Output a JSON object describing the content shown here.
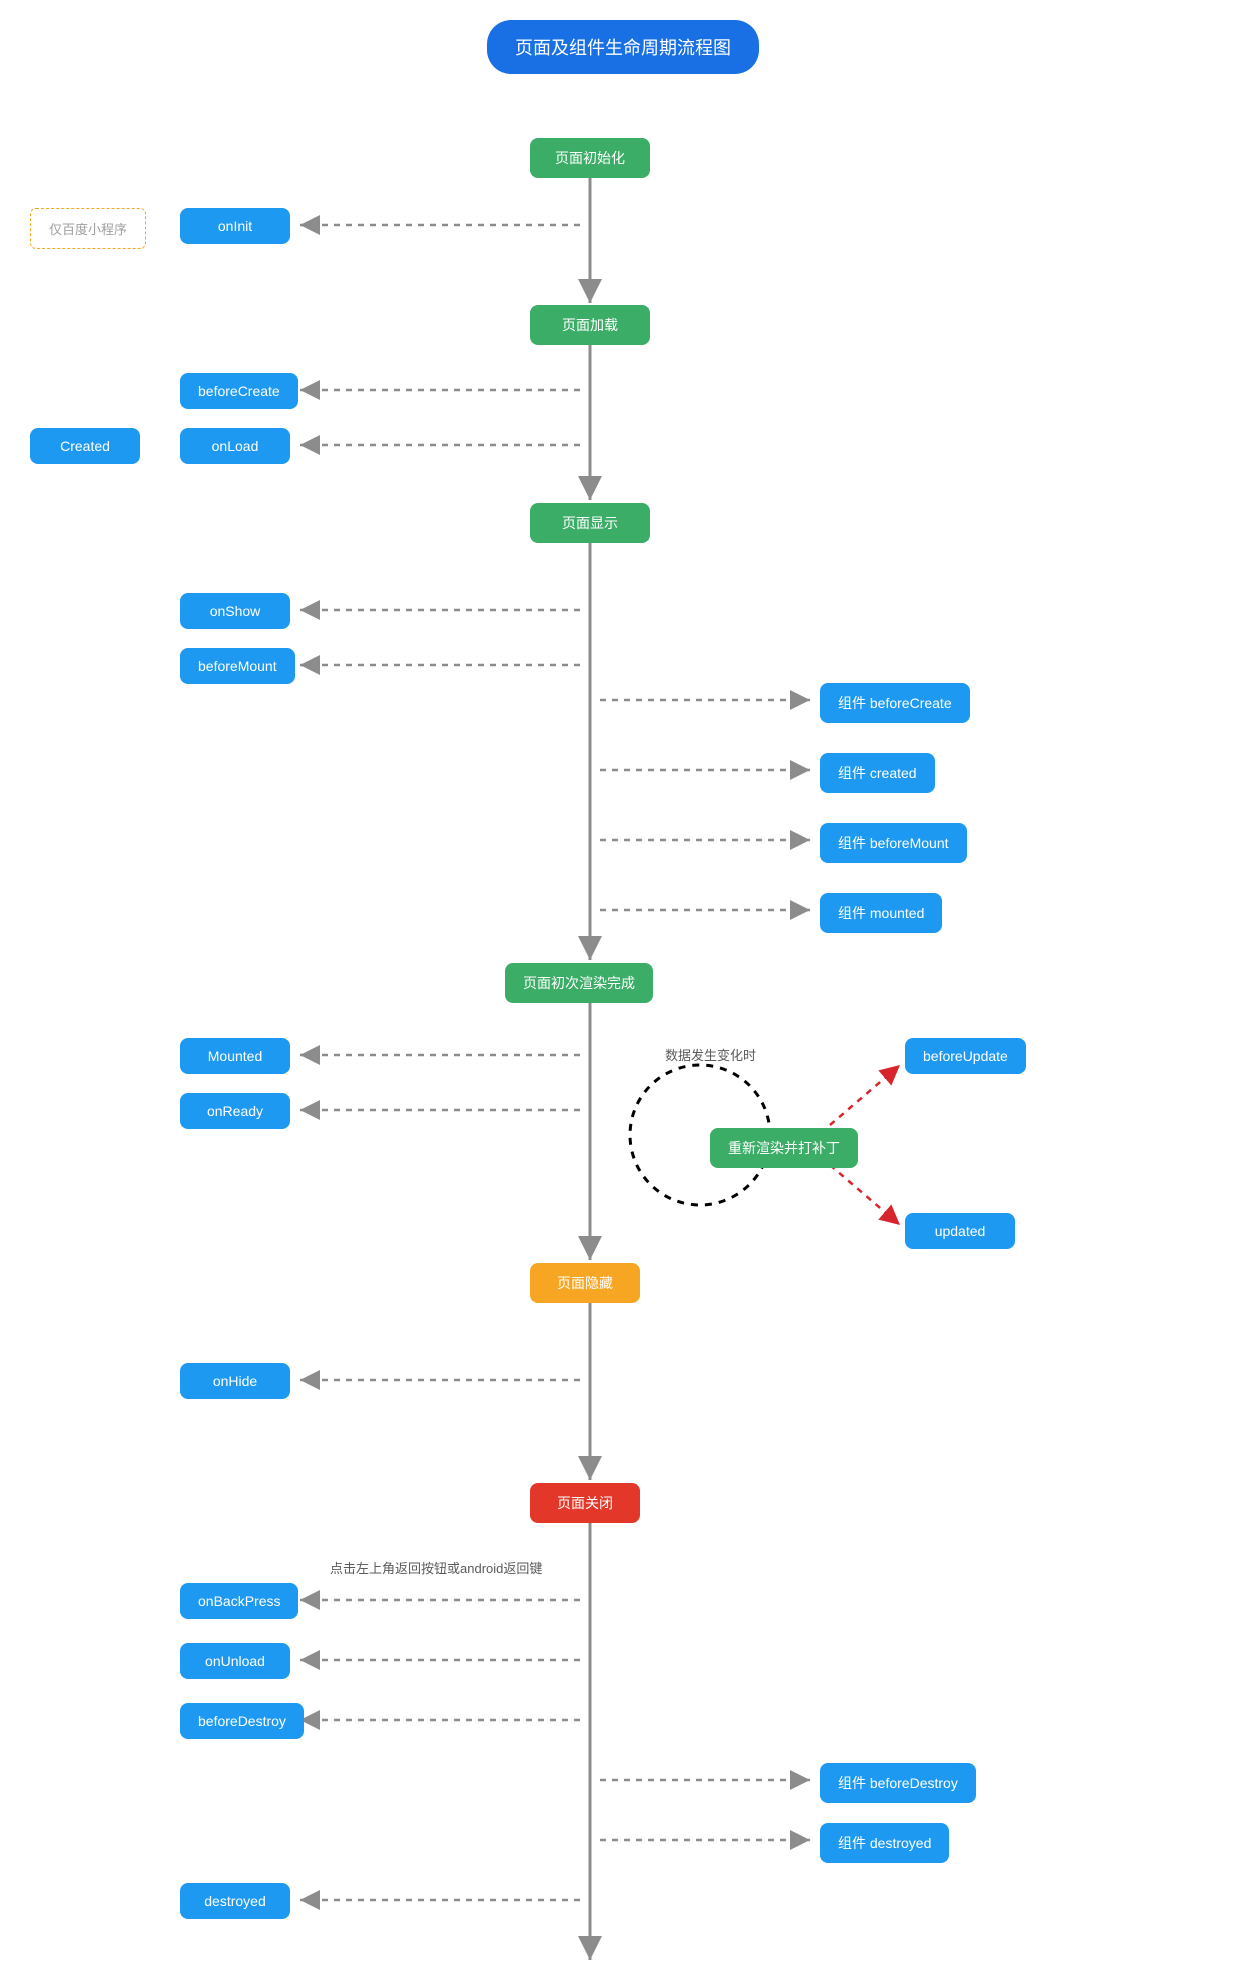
{
  "title": "页面及组件生命周期流程图",
  "stages": {
    "init": "页面初始化",
    "load": "页面加载",
    "show": "页面显示",
    "first_render": "页面初次渲染完成",
    "rerender": "重新渲染并打补丁",
    "hide": "页面隐藏",
    "close": "页面关闭"
  },
  "left_hooks": {
    "onInit": "onInit",
    "beforeCreate": "beforeCreate",
    "onLoad": "onLoad",
    "onShow": "onShow",
    "beforeMount": "beforeMount",
    "Mounted": "Mounted",
    "onReady": "onReady",
    "onHide": "onHide",
    "onBackPress": "onBackPress",
    "onUnload": "onUnload",
    "beforeDestroy": "beforeDestroy",
    "destroyed": "destroyed"
  },
  "side": {
    "Created": "Created",
    "baidu_only": "仅百度小程序"
  },
  "right_hooks": {
    "comp_beforeCreate": "组件 beforeCreate",
    "comp_created": "组件 created",
    "comp_beforeMount": "组件 beforeMount",
    "comp_mounted": "组件 mounted",
    "beforeUpdate": "beforeUpdate",
    "updated": "updated",
    "comp_beforeDestroy": "组件 beforeDestroy",
    "comp_destroyed": "组件 destroyed"
  },
  "notes": {
    "data_change": "数据发生变化时",
    "back_press": "点击左上角返回按钮或android返回键"
  }
}
